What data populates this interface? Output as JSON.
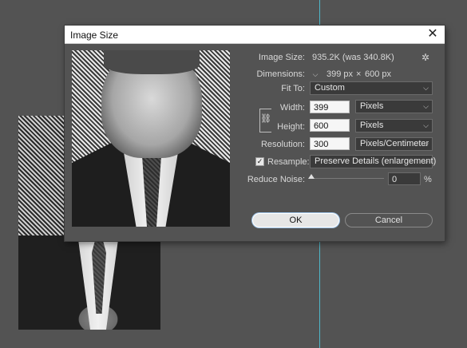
{
  "dialog": {
    "title": "Image Size",
    "close_glyph": "✕"
  },
  "image_size": {
    "label": "Image Size:",
    "value": "935.2K (was 340.8K)",
    "gear_icon": "gear-icon"
  },
  "dimensions": {
    "label": "Dimensions:",
    "width": "399 px",
    "separator": "×",
    "height": "600 px"
  },
  "fit_to": {
    "label": "Fit To:",
    "selected": "Custom"
  },
  "width": {
    "label": "Width:",
    "value": "399",
    "unit": "Pixels"
  },
  "height": {
    "label": "Height:",
    "value": "600",
    "unit": "Pixels"
  },
  "resolution": {
    "label": "Resolution:",
    "value": "300",
    "unit": "Pixels/Centimeter"
  },
  "resample": {
    "label": "Resample:",
    "checked": true,
    "selected": "Preserve Details (enlargement)"
  },
  "reduce_noise": {
    "label": "Reduce Noise:",
    "value": "0",
    "unit": "%",
    "level_percent": 0
  },
  "buttons": {
    "ok": "OK",
    "cancel": "Cancel"
  },
  "colors": {
    "app_background": "#535353",
    "guide": "#4fb8c9"
  }
}
